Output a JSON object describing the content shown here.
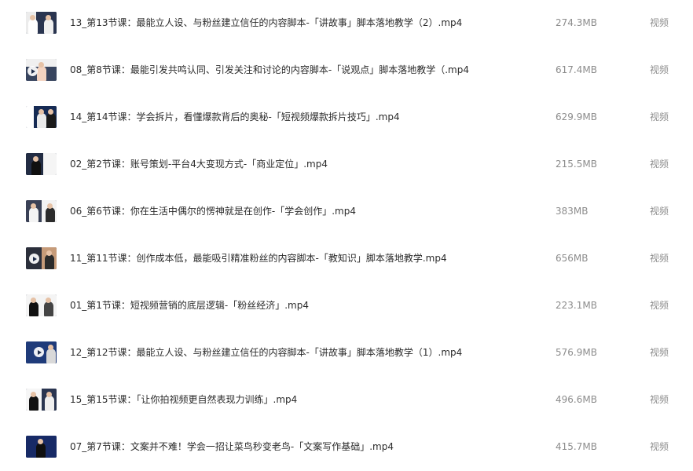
{
  "files": [
    {
      "name": "13_第13节课：最能立人设、与粉丝建立信任的内容脚本-「讲故事」脚本落地教学（2）.mp4",
      "size": "274.3MB",
      "type": "视频"
    },
    {
      "name": "08_第8节课：最能引发共鸣认同、引发关注和讨论的内容脚本-「说观点」脚本落地教学（.mp4",
      "size": "617.4MB",
      "type": "视频"
    },
    {
      "name": "14_第14节课：学会拆片，看懂爆款背后的奥秘-「短视频爆款拆片技巧」.mp4",
      "size": "629.9MB",
      "type": "视频"
    },
    {
      "name": "02_第2节课：账号策划-平台4大变现方式-「商业定位」.mp4",
      "size": "215.5MB",
      "type": "视频"
    },
    {
      "name": "06_第6节课：你在生活中偶尔的愣神就是在创作-「学会创作」.mp4",
      "size": "383MB",
      "type": "视频"
    },
    {
      "name": "11_第11节课：创作成本低，最能吸引精准粉丝的内容脚本-「教知识」脚本落地教学.mp4",
      "size": "656MB",
      "type": "视频"
    },
    {
      "name": "01_第1节课：短视频营销的底层逻辑-「粉丝经济」.mp4",
      "size": "223.1MB",
      "type": "视频"
    },
    {
      "name": "12_第12节课：最能立人设、与粉丝建立信任的内容脚本-「讲故事」脚本落地教学（1）.mp4",
      "size": "576.9MB",
      "type": "视频"
    },
    {
      "name": "15_第15节课：「让你拍视频更自然表现力训练」.mp4",
      "size": "496.6MB",
      "type": "视频"
    },
    {
      "name": "07_第7节课：文案并不难！学会一招让菜鸟秒变老鸟-「文案写作基础」.mp4",
      "size": "415.7MB",
      "type": "视频"
    }
  ],
  "thumbnail": {
    "icon": "video-thumbnail-icon",
    "colors": {
      "primary": "#23324d",
      "secondary": "#eeeeee",
      "skin": "#e6c2a6",
      "shirt": "#f1f1f1",
      "dark": "#1f2630"
    }
  }
}
